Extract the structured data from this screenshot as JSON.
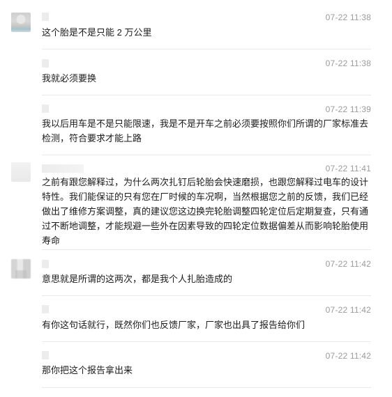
{
  "messages": [
    {
      "time": "07-22 11:38",
      "text": "这个胎是不是只能 2 万公里"
    },
    {
      "time": "07-22 11:38",
      "text": "我就必须要换"
    },
    {
      "time": "07-22 11:39",
      "text": "我以后用车是不是只能限速，我是不是开车之前必须要按照你们所谓的厂家标准去检测，符合要求才能上路"
    },
    {
      "time": "07-22 11:41",
      "text": "之前有跟您解释过，为什么两次扎钉后轮胎会快速磨损，也跟您解释过电车的设计特性。我们能保证的只有您在厂时候的车况啊，当然根据您之前的反馈，我们已经做出了维修方案调整，真的建议您这边换完轮胎调整四轮定位后定期复查，只有通过不断地调整，才能规避一些外在因素导致的四轮定位数据偏差从而影响轮胎使用寿命"
    },
    {
      "time": "07-22 11:42",
      "text": "意思就是所谓的这两次，都是我个人扎胎造成的"
    },
    {
      "time": "07-22 11:42",
      "text": "有你这句话就行，既然你们也反馈厂家，厂家也出具了报告给你们"
    },
    {
      "time": "07-22 11:42",
      "text": "那你把这个报告拿出来"
    }
  ]
}
